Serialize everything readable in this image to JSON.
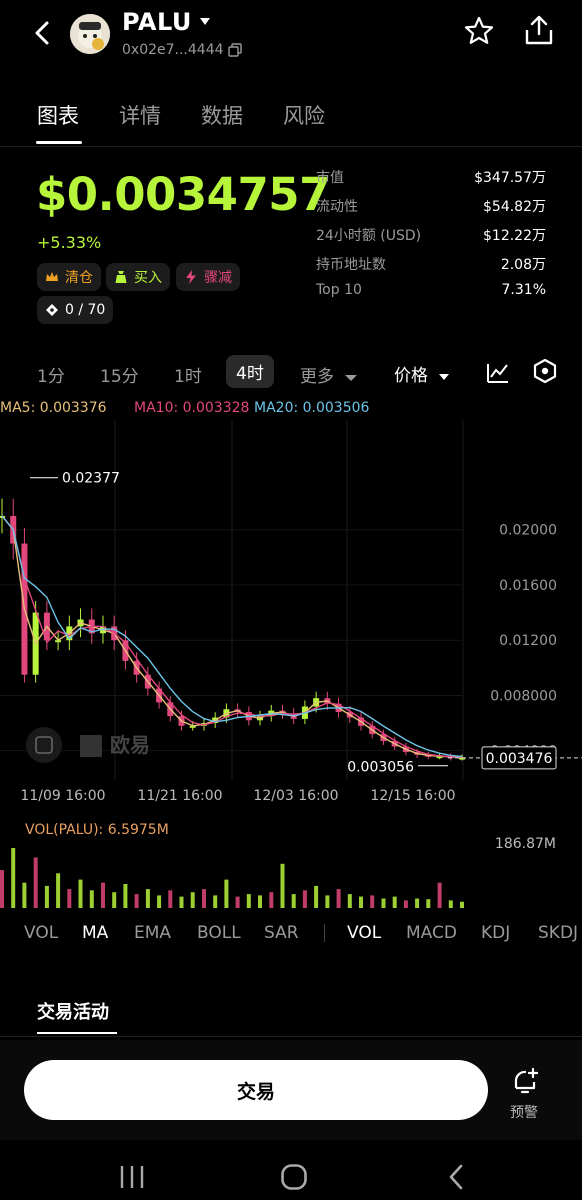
{
  "header": {
    "token_name": "PALU",
    "address": "0x02e7...4444"
  },
  "tabs": [
    "图表",
    "详情",
    "数据",
    "风险"
  ],
  "price": {
    "value": "$0.0034757",
    "change": "+5.33%"
  },
  "chips": {
    "clear": "清仓",
    "buy": "买入",
    "dump": "骤减",
    "holders_progress": "0 / 70"
  },
  "stats": [
    {
      "label": "市值",
      "value": "$347.57万"
    },
    {
      "label": "流动性",
      "value": "$54.82万"
    },
    {
      "label": "24小时额 (USD)",
      "value": "$12.22万"
    },
    {
      "label": "持币地址数",
      "value": "2.08万"
    },
    {
      "label": "Top 10",
      "value": "7.31%"
    }
  ],
  "intervals": {
    "items": [
      "1分",
      "15分",
      "1时",
      "4时"
    ],
    "active": "4时",
    "more": "更多",
    "price_selector": "价格"
  },
  "ma_legend": {
    "ma5": "MA5: 0.003376",
    "ma10": "MA10: 0.003328",
    "ma20": "MA20: 0.003506"
  },
  "colors": {
    "up": "#b7f53b",
    "down": "#e2477d",
    "ma5": "#e8c07a",
    "ma10": "#e2477d",
    "ma20": "#6ec4e8"
  },
  "chart_data": {
    "type": "line",
    "y_ticks": [
      "0.02000",
      "0.01600",
      "0.01200",
      "0.008000",
      "0.004000"
    ],
    "x_ticks": [
      "11/09 16:00",
      "11/21 16:00",
      "12/03 16:00",
      "12/15 16:00"
    ],
    "high_label": "0.02377",
    "low_label": "0.003056",
    "last_price_label": "0.003476",
    "watermark": "欧易",
    "ylim": [
      0.0026,
      0.0265
    ],
    "price": [
      0.021,
      0.019,
      0.0095,
      0.014,
      0.012,
      0.012,
      0.013,
      0.0135,
      0.0125,
      0.013,
      0.012,
      0.0105,
      0.0095,
      0.0085,
      0.0075,
      0.0065,
      0.0058,
      0.0058,
      0.006,
      0.0064,
      0.007,
      0.0068,
      0.0062,
      0.0065,
      0.0069,
      0.0067,
      0.0063,
      0.0072,
      0.0078,
      0.0074,
      0.0068,
      0.0064,
      0.0058,
      0.0052,
      0.0047,
      0.0043,
      0.0039,
      0.0037,
      0.0036,
      0.0036,
      0.0035,
      0.0035
    ]
  },
  "volume": {
    "label": "VOL(PALU): 6.5975M",
    "max_label": "186.87M",
    "values": [
      60,
      95,
      40,
      80,
      35,
      55,
      30,
      45,
      28,
      40,
      25,
      38,
      22,
      30,
      20,
      28,
      18,
      25,
      30,
      20,
      45,
      18,
      22,
      20,
      25,
      70,
      22,
      28,
      35,
      20,
      30,
      22,
      18,
      20,
      15,
      18,
      12,
      15,
      14,
      40,
      12,
      10
    ]
  },
  "indicators": {
    "main": [
      "VOL",
      "MA",
      "EMA",
      "BOLL",
      "SAR"
    ],
    "sub": [
      "VOL",
      "MACD",
      "KDJ",
      "SKDJ"
    ]
  },
  "section": {
    "title": "交易活动"
  },
  "bottom": {
    "trade_label": "交易",
    "alert_label": "预警"
  }
}
